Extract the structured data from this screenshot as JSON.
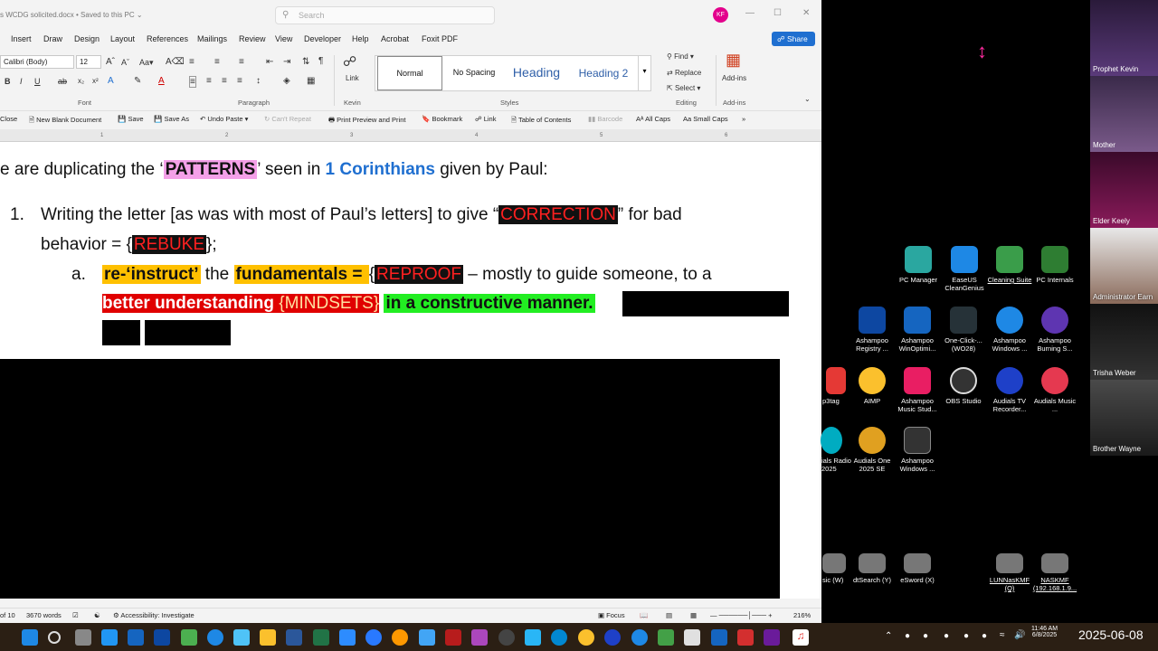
{
  "word": {
    "title": "s WCDG solicited.docx • Saved to this PC ⌄",
    "search_placeholder": "Search",
    "avatar_initials": "KF",
    "share_label": "Share",
    "menu": [
      "Insert",
      "Draw",
      "Design",
      "Layout",
      "References",
      "Mailings",
      "Review",
      "View",
      "Developer",
      "Help",
      "Acrobat",
      "Foxit PDF"
    ],
    "ribbon": {
      "font_name": "Calibri (Body)",
      "font_size": "12",
      "group_font": "Font",
      "group_paragraph": "Paragraph",
      "group_kevin": "Kevin",
      "link_label": "Link",
      "styles": [
        "Normal",
        "No Spacing",
        "Heading",
        "Heading 2"
      ],
      "group_styles": "Styles",
      "find_label": "Find",
      "replace_label": "Replace",
      "select_label": "Select",
      "group_editing": "Editing",
      "addins_label": "Add-ins",
      "group_addins": "Add-ins"
    },
    "qat": [
      "Close",
      "New Blank Document",
      "Save",
      "Save As",
      "Undo Paste",
      "Can't Repeat",
      "Print Preview and Print",
      "Bookmark",
      "Link",
      "Table of Contents",
      "Barcode",
      "All Caps",
      "Small Caps"
    ],
    "ruler_ticks": [
      "1",
      "2",
      "3",
      "4",
      "5",
      "6"
    ],
    "doc": {
      "l1_a": "e are duplicating the ‘",
      "l1_patterns": "PATTERNS",
      "l1_b": "’ seen in ",
      "l1_cor": "1 Corinthians",
      "l1_c": " given by Paul:",
      "l2_num": "1.",
      "l2_a": "Writing the letter [as was with most of Paul’s letters] to give “",
      "l2_correction": "CORRECTION",
      "l2_b": "” for bad",
      "l3_a": "behavior = {",
      "l3_rebuke": "REBUKE",
      "l3_b": "};",
      "l4_num": "a.",
      "l4_reinstruct": "re-‘instruct’",
      "l4_a": " the ",
      "l4_fund": "fundamentals = ",
      "l4_b": "{",
      "l4_reproof": "REPROOF",
      "l4_c": " – mostly to guide someone, to a",
      "l5_better": "better understanding ",
      "l5_mindsets": "{MINDSETS}",
      "l5_green": "in a constructive manner."
    },
    "status": {
      "pages": "of 10",
      "words": "3670 words",
      "accessibility": "Accessibility: Investigate",
      "focus": "Focus",
      "zoom": "216%"
    }
  },
  "desktop": {
    "icons": [
      {
        "label": "PC Manager",
        "color": "#2aa7a0"
      },
      {
        "label": "EaseUS CleanGenius",
        "color": "#1e88e5"
      },
      {
        "label": "Cleaning Suite",
        "color": "#3a9d4a"
      },
      {
        "label": "PC Internals",
        "color": "#2e7d32"
      },
      {
        "label": "Ashampoo Registry ...",
        "color": "#0d47a1"
      },
      {
        "label": "Ashampoo WinOptimi...",
        "color": "#1565c0"
      },
      {
        "label": "One-Click-... (WO28)",
        "color": "#263238"
      },
      {
        "label": "Ashampoo Windows ...",
        "color": "#1e88e5"
      },
      {
        "label": "Ashampoo Burning S...",
        "color": "#5e35b1"
      },
      {
        "label": "p3tag",
        "color": "#e53935"
      },
      {
        "label": "AIMP",
        "color": "#fbc02d"
      },
      {
        "label": "Ashampoo Music Stud...",
        "color": "#e91e63"
      },
      {
        "label": "OBS Studio",
        "color": "#333333"
      },
      {
        "label": "Audials TV Recorder...",
        "color": "#1e40c8"
      },
      {
        "label": "Audials Music ...",
        "color": "#e53950"
      },
      {
        "label": "ials Radio 2025",
        "color": "#00acc1"
      },
      {
        "label": "Audials One 2025 SE",
        "color": "#e0a020"
      },
      {
        "label": "Ashampoo Windows ...",
        "color": "#333333"
      },
      {
        "label": "sic (W)",
        "color": "#777777"
      },
      {
        "label": "dtSearch (Y)",
        "color": "#777777"
      },
      {
        "label": "eSword (X)",
        "color": "#777777"
      },
      {
        "label": "LUNNasKMF (Q)",
        "color": "#777777"
      },
      {
        "label": "NASKMF (192.168.1.9...",
        "color": "#777777"
      }
    ]
  },
  "participants": [
    "Prophet Kevin",
    "Mother",
    "Elder Keely",
    "Administrator Earn",
    "Trisha Weber",
    "Brother Wayne"
  ],
  "taskbar": {
    "time": "11:46 AM",
    "date": "6/8/2025",
    "big_date": "2025-06-08"
  }
}
